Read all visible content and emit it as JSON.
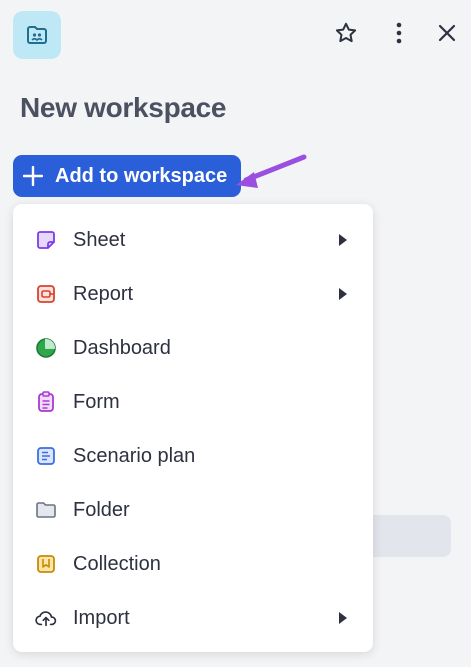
{
  "header": {
    "app_icon": "workspace-icon",
    "actions": [
      "star-icon",
      "more-vertical-icon",
      "close-icon"
    ]
  },
  "page": {
    "title": "New workspace"
  },
  "add_button": {
    "label": "Add to workspace",
    "icon": "plus-icon",
    "color": "#2b5fd9"
  },
  "menu": {
    "items": [
      {
        "label": "Sheet",
        "icon": "sheet-icon",
        "color": "#8b5cf6",
        "submenu": true
      },
      {
        "label": "Report",
        "icon": "report-icon",
        "color": "#e05a47",
        "submenu": true
      },
      {
        "label": "Dashboard",
        "icon": "dashboard-icon",
        "color": "#2ea84a",
        "submenu": false
      },
      {
        "label": "Form",
        "icon": "form-icon",
        "color": "#b24fd6",
        "submenu": false
      },
      {
        "label": "Scenario plan",
        "icon": "scenario-plan-icon",
        "color": "#3b6fe0",
        "submenu": false
      },
      {
        "label": "Folder",
        "icon": "folder-icon",
        "color": "#6b7280",
        "submenu": false
      },
      {
        "label": "Collection",
        "icon": "collection-icon",
        "color": "#e0a21a",
        "submenu": false
      },
      {
        "label": "Import",
        "icon": "import-icon",
        "color": "#2d3140",
        "submenu": true
      }
    ]
  },
  "annotation": {
    "arrow_color": "#9b4fe0"
  }
}
